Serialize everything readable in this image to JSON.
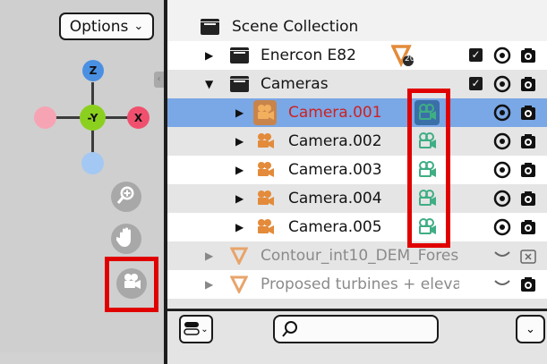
{
  "viewport": {
    "options_label": "Options",
    "options_chevron": "⌄",
    "axis_labels": {
      "z": "Z",
      "y": "-Y",
      "x": "X"
    },
    "axis_colors": {
      "z": "#4a90e2",
      "y": "#8cd01f",
      "x": "#f0506e",
      "neg_x": "#f6a4b4",
      "neg_z": "#a3c8f3"
    },
    "nav_icons": [
      "zoom-icon",
      "hand-pan-icon",
      "camera-view-icon"
    ],
    "nav_tab_arrow": "‹"
  },
  "outliner": {
    "root_label": "Scene Collection",
    "rows": [
      {
        "label": "Enercon E82",
        "kind": "collection",
        "badge": "20"
      },
      {
        "label": "Cameras",
        "kind": "collection",
        "expanded": true
      },
      {
        "label": "Camera.001",
        "kind": "camera",
        "selected": true
      },
      {
        "label": "Camera.002",
        "kind": "camera"
      },
      {
        "label": "Camera.003",
        "kind": "camera"
      },
      {
        "label": "Camera.004",
        "kind": "camera"
      },
      {
        "label": "Camera.005",
        "kind": "camera"
      },
      {
        "label": "Contour_int10_DEM_Fores",
        "kind": "mesh",
        "hidden": true
      },
      {
        "label": "Proposed turbines + eleva",
        "kind": "mesh",
        "hidden": true
      }
    ],
    "checkbox_mark": "✓",
    "colors": {
      "selected_row": "#7aa7e6",
      "selected_text": "#cc2222",
      "alt_row": "#e5e5e5",
      "camera_orange": "#e38b3a",
      "camera_green": "#3fae84",
      "mesh_orange": "#e8a46a"
    }
  },
  "bottom": {
    "dropdown_chevron": "⌄",
    "filter_chevron": "⌄",
    "search_value": ""
  },
  "highlights": {
    "color": "#e00000"
  }
}
